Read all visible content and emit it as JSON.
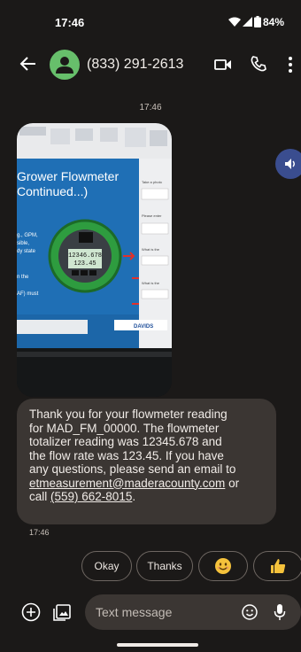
{
  "status_bar": {
    "time": "17:46",
    "battery": "84%"
  },
  "header": {
    "contact": "(833) 291-2613"
  },
  "conversation": {
    "timestamp_top": "17:46",
    "message": {
      "line1": "Thank you for your flowmeter reading",
      "line2": "for MAD_FM_00000. The flowmeter",
      "line3": "totalizer reading was 12345.678 and",
      "line4": "the flow rate was 123.45. If you have",
      "line5": "any questions, please send an email to",
      "email": "etmeasurement@maderacounty.com",
      "or": " or",
      "call": "call ",
      "phone": "(559) 662-8015",
      "period": "."
    },
    "timestamp_msg": "17:46"
  },
  "image": {
    "title_line1": "Grower Flowmeter",
    "title_line2": "Continued...)",
    "side_text": [
      "g., GPM,",
      "sible,",
      "dy state",
      "",
      "n the",
      "AF) must"
    ],
    "display_total": "12346.678",
    "display_rate": "123.45",
    "footer_brand": "DAVIDS",
    "right_panel": [
      "Take a photo",
      "Please enter",
      "What is the",
      "What is the"
    ]
  },
  "smart_replies": {
    "okay": "Okay",
    "thanks": "Thanks",
    "smile": "😊",
    "thumb": "👍"
  },
  "composer": {
    "placeholder": "Text message"
  },
  "colors": {
    "background": "#1b1918",
    "bubble": "#3b3633",
    "avatar": "#67bf6b",
    "volume": "#3a4d8f"
  }
}
